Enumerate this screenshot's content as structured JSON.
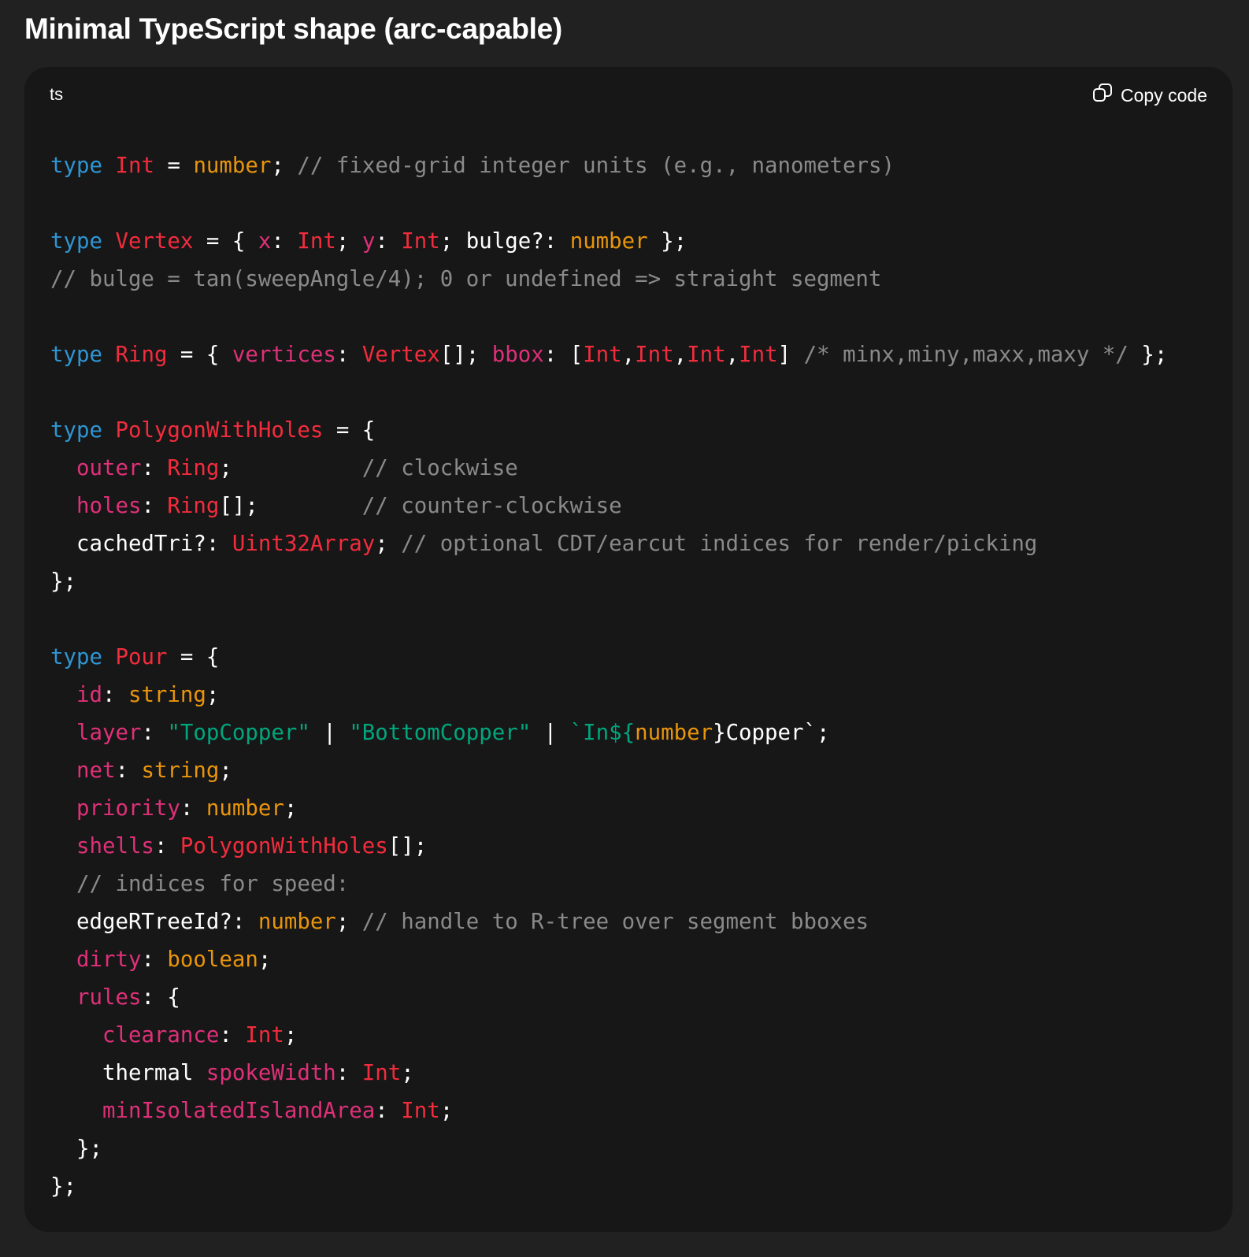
{
  "heading": "Minimal TypeScript shape (arc-capable)",
  "code_block": {
    "language": "ts",
    "copy_label": "Copy code",
    "copy_icon": "copy-icon",
    "colors": {
      "keyword": "#2e95d3",
      "type": "#f22c3d",
      "property": "#df3079",
      "builtin": "#e9950c",
      "string": "#00a67d",
      "comment": "#8a8a8a",
      "background": "#171717"
    },
    "lines": [
      [
        [
          "k",
          "type"
        ],
        [
          "w",
          " "
        ],
        [
          "t",
          "Int"
        ],
        [
          "w",
          " = "
        ],
        [
          "b",
          "number"
        ],
        [
          "w",
          "; "
        ],
        [
          "c",
          "// fixed-grid integer units (e.g., nanometers)"
        ]
      ],
      [],
      [
        [
          "k",
          "type"
        ],
        [
          "w",
          " "
        ],
        [
          "t",
          "Vertex"
        ],
        [
          "w",
          " = { "
        ],
        [
          "p",
          "x"
        ],
        [
          "w",
          ": "
        ],
        [
          "t",
          "Int"
        ],
        [
          "w",
          "; "
        ],
        [
          "p",
          "y"
        ],
        [
          "w",
          ": "
        ],
        [
          "t",
          "Int"
        ],
        [
          "w",
          "; bulge?: "
        ],
        [
          "b",
          "number"
        ],
        [
          "w",
          " };"
        ]
      ],
      [
        [
          "c",
          "// bulge = tan(sweepAngle/4); 0 or undefined => straight segment"
        ]
      ],
      [],
      [
        [
          "k",
          "type"
        ],
        [
          "w",
          " "
        ],
        [
          "t",
          "Ring"
        ],
        [
          "w",
          " = { "
        ],
        [
          "p",
          "vertices"
        ],
        [
          "w",
          ": "
        ],
        [
          "t",
          "Vertex"
        ],
        [
          "w",
          "[]; "
        ],
        [
          "p",
          "bbox"
        ],
        [
          "w",
          ": ["
        ],
        [
          "t",
          "Int"
        ],
        [
          "w",
          ","
        ],
        [
          "t",
          "Int"
        ],
        [
          "w",
          ","
        ],
        [
          "t",
          "Int"
        ],
        [
          "w",
          ","
        ],
        [
          "t",
          "Int"
        ],
        [
          "w",
          "] "
        ],
        [
          "c",
          "/* minx,miny,maxx,maxy */"
        ],
        [
          "w",
          " };"
        ]
      ],
      [],
      [
        [
          "k",
          "type"
        ],
        [
          "w",
          " "
        ],
        [
          "t",
          "PolygonWithHoles"
        ],
        [
          "w",
          " = {"
        ]
      ],
      [
        [
          "w",
          "  "
        ],
        [
          "p",
          "outer"
        ],
        [
          "w",
          ": "
        ],
        [
          "t",
          "Ring"
        ],
        [
          "w",
          ";          "
        ],
        [
          "c",
          "// clockwise"
        ]
      ],
      [
        [
          "w",
          "  "
        ],
        [
          "p",
          "holes"
        ],
        [
          "w",
          ": "
        ],
        [
          "t",
          "Ring"
        ],
        [
          "w",
          "[];        "
        ],
        [
          "c",
          "// counter-clockwise"
        ]
      ],
      [
        [
          "w",
          "  cachedTri?: "
        ],
        [
          "t",
          "Uint32Array"
        ],
        [
          "w",
          "; "
        ],
        [
          "c",
          "// optional CDT/earcut indices for render/picking"
        ]
      ],
      [
        [
          "w",
          "};"
        ]
      ],
      [],
      [
        [
          "k",
          "type"
        ],
        [
          "w",
          " "
        ],
        [
          "t",
          "Pour"
        ],
        [
          "w",
          " = {"
        ]
      ],
      [
        [
          "w",
          "  "
        ],
        [
          "p",
          "id"
        ],
        [
          "w",
          ": "
        ],
        [
          "b",
          "string"
        ],
        [
          "w",
          ";"
        ]
      ],
      [
        [
          "w",
          "  "
        ],
        [
          "p",
          "layer"
        ],
        [
          "w",
          ": "
        ],
        [
          "s",
          "\"TopCopper\""
        ],
        [
          "w",
          " | "
        ],
        [
          "s",
          "\"BottomCopper\""
        ],
        [
          "w",
          " | "
        ],
        [
          "s",
          "`In${"
        ],
        [
          "b",
          "number"
        ],
        [
          "w",
          "}Copper`;"
        ]
      ],
      [
        [
          "w",
          "  "
        ],
        [
          "p",
          "net"
        ],
        [
          "w",
          ": "
        ],
        [
          "b",
          "string"
        ],
        [
          "w",
          ";"
        ]
      ],
      [
        [
          "w",
          "  "
        ],
        [
          "p",
          "priority"
        ],
        [
          "w",
          ": "
        ],
        [
          "b",
          "number"
        ],
        [
          "w",
          ";"
        ]
      ],
      [
        [
          "w",
          "  "
        ],
        [
          "p",
          "shells"
        ],
        [
          "w",
          ": "
        ],
        [
          "t",
          "PolygonWithHoles"
        ],
        [
          "w",
          "[];"
        ]
      ],
      [
        [
          "w",
          "  "
        ],
        [
          "c",
          "// indices for speed:"
        ]
      ],
      [
        [
          "w",
          "  edgeRTreeId?: "
        ],
        [
          "b",
          "number"
        ],
        [
          "w",
          "; "
        ],
        [
          "c",
          "// handle to R-tree over segment bboxes"
        ]
      ],
      [
        [
          "w",
          "  "
        ],
        [
          "p",
          "dirty"
        ],
        [
          "w",
          ": "
        ],
        [
          "b",
          "boolean"
        ],
        [
          "w",
          ";"
        ]
      ],
      [
        [
          "w",
          "  "
        ],
        [
          "p",
          "rules"
        ],
        [
          "w",
          ": {"
        ]
      ],
      [
        [
          "w",
          "    "
        ],
        [
          "p",
          "clearance"
        ],
        [
          "w",
          ": "
        ],
        [
          "t",
          "Int"
        ],
        [
          "w",
          ";"
        ]
      ],
      [
        [
          "w",
          "    thermal "
        ],
        [
          "p",
          "spokeWidth"
        ],
        [
          "w",
          ": "
        ],
        [
          "t",
          "Int"
        ],
        [
          "w",
          ";"
        ]
      ],
      [
        [
          "w",
          "    "
        ],
        [
          "p",
          "minIsolatedIslandArea"
        ],
        [
          "w",
          ": "
        ],
        [
          "t",
          "Int"
        ],
        [
          "w",
          ";"
        ]
      ],
      [
        [
          "w",
          "  };"
        ]
      ],
      [
        [
          "w",
          "};"
        ]
      ]
    ]
  }
}
